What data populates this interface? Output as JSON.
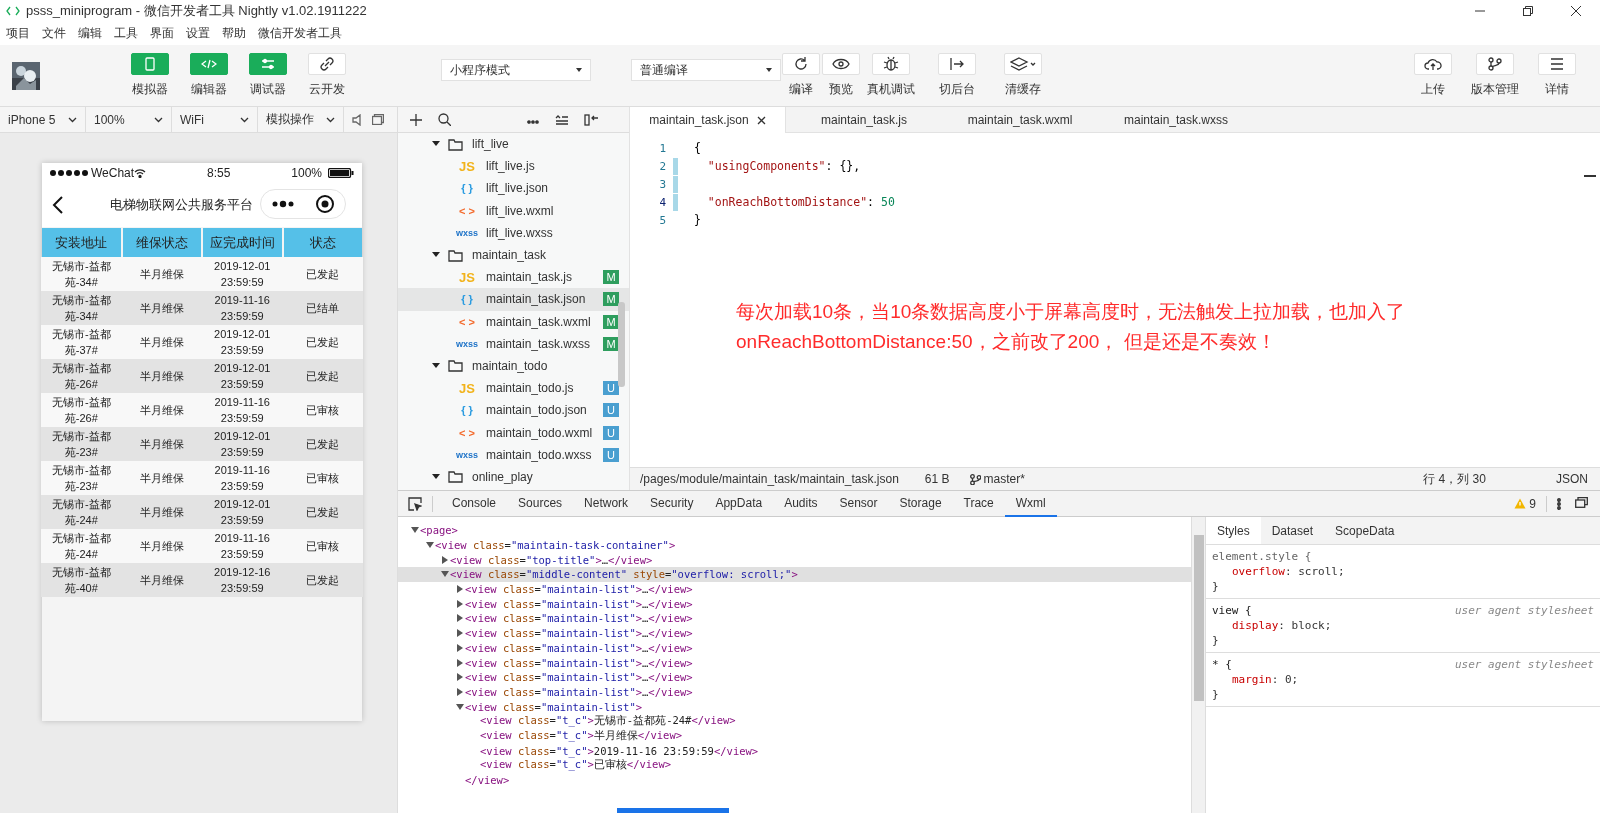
{
  "window": {
    "title": "psss_miniprogram - 微信开发者工具 Nightly v1.02.1911222"
  },
  "menu": [
    "项目",
    "文件",
    "编辑",
    "工具",
    "界面",
    "设置",
    "帮助",
    "微信开发者工具"
  ],
  "toolbar": {
    "view_buttons": [
      {
        "label": "模拟器",
        "kind": "phone",
        "on": true
      },
      {
        "label": "编辑器",
        "kind": "code",
        "on": true
      },
      {
        "label": "调试器",
        "kind": "sliders",
        "on": true
      },
      {
        "label": "云开发",
        "kind": "link",
        "on": false
      }
    ],
    "mode_select": "小程序模式",
    "compile_select": "普通编译",
    "actions": [
      {
        "label": "编译",
        "kind": "refresh"
      },
      {
        "label": "预览",
        "kind": "eye"
      },
      {
        "label": "真机调试",
        "kind": "bug"
      },
      {
        "label": "切后台",
        "kind": "exit"
      },
      {
        "label": "清缓存",
        "kind": "layers"
      }
    ],
    "right_actions": [
      {
        "label": "上传",
        "kind": "upload"
      },
      {
        "label": "版本管理",
        "kind": "branch"
      },
      {
        "label": "详情",
        "kind": "menu"
      }
    ]
  },
  "simulator": {
    "device": "iPhone 5",
    "zoom": "100%",
    "network": "WiFi",
    "operation": "模拟操作",
    "phone": {
      "carrier": "WeChat",
      "time": "8:55",
      "battery": "100%",
      "nav_title": "电梯物联网公共服务平台",
      "columns": [
        "安装地址",
        "维保状态",
        "应完成时间",
        "状态"
      ],
      "rows": [
        [
          "无锡市-益都苑-34#",
          "半月维保",
          "2019-12-01 23:59:59",
          "已发起"
        ],
        [
          "无锡市-益都苑-34#",
          "半月维保",
          "2019-11-16 23:59:59",
          "已结单"
        ],
        [
          "无锡市-益都苑-37#",
          "半月维保",
          "2019-12-01 23:59:59",
          "已发起"
        ],
        [
          "无锡市-益都苑-26#",
          "半月维保",
          "2019-12-01 23:59:59",
          "已发起"
        ],
        [
          "无锡市-益都苑-26#",
          "半月维保",
          "2019-11-16 23:59:59",
          "已审核"
        ],
        [
          "无锡市-益都苑-23#",
          "半月维保",
          "2019-12-01 23:59:59",
          "已发起"
        ],
        [
          "无锡市-益都苑-23#",
          "半月维保",
          "2019-11-16 23:59:59",
          "已审核"
        ],
        [
          "无锡市-益都苑-24#",
          "半月维保",
          "2019-12-01 23:59:59",
          "已发起"
        ],
        [
          "无锡市-益都苑-24#",
          "半月维保",
          "2019-11-16 23:59:59",
          "已审核"
        ],
        [
          "无锡市-益都苑-40#",
          "半月维保",
          "2019-12-16 23:59:59",
          "已发起"
        ]
      ]
    }
  },
  "file_tree": [
    {
      "name": "lift_live",
      "expanded": true,
      "children": [
        {
          "name": "lift_live.js",
          "icon": "JS",
          "kind": "js",
          "selected": false
        },
        {
          "name": "lift_live.json",
          "icon": "{ }",
          "kind": "json",
          "selected": false
        },
        {
          "name": "lift_live.wxml",
          "icon": "< >",
          "kind": "wxml",
          "selected": false
        },
        {
          "name": "lift_live.wxss",
          "icon": "wxss",
          "kind": "wxss",
          "selected": false
        }
      ]
    },
    {
      "name": "maintain_task",
      "expanded": true,
      "children": [
        {
          "name": "maintain_task.js",
          "icon": "JS",
          "kind": "js",
          "selected": false,
          "badge": {
            "label": "M",
            "color": "#2e9e5e"
          }
        },
        {
          "name": "maintain_task.json",
          "icon": "{ }",
          "kind": "json",
          "selected": true,
          "badge": {
            "label": "M",
            "color": "#2e9e5e"
          }
        },
        {
          "name": "maintain_task.wxml",
          "icon": "< >",
          "kind": "wxml",
          "selected": false,
          "badge": {
            "label": "M",
            "color": "#2e9e5e"
          }
        },
        {
          "name": "maintain_task.wxss",
          "icon": "wxss",
          "kind": "wxss",
          "selected": false,
          "badge": {
            "label": "M",
            "color": "#2e9e5e"
          }
        }
      ]
    },
    {
      "name": "maintain_todo",
      "expanded": true,
      "children": [
        {
          "name": "maintain_todo.js",
          "icon": "JS",
          "kind": "js",
          "selected": false,
          "badge": {
            "label": "U",
            "color": "#4a9fd0"
          }
        },
        {
          "name": "maintain_todo.json",
          "icon": "{ }",
          "kind": "json",
          "selected": false,
          "badge": {
            "label": "U",
            "color": "#4a9fd0"
          }
        },
        {
          "name": "maintain_todo.wxml",
          "icon": "< >",
          "kind": "wxml",
          "selected": false,
          "badge": {
            "label": "U",
            "color": "#4a9fd0"
          }
        },
        {
          "name": "maintain_todo.wxss",
          "icon": "wxss",
          "kind": "wxss",
          "selected": false,
          "badge": {
            "label": "U",
            "color": "#4a9fd0"
          }
        }
      ]
    },
    {
      "name": "online_play",
      "expanded": true
    }
  ],
  "editor": {
    "tabs": [
      {
        "label": "maintain_task.json",
        "selected": true
      },
      {
        "label": "maintain_task.js",
        "selected": false
      },
      {
        "label": "maintain_task.wxml",
        "selected": false
      },
      {
        "label": "maintain_task.wxss",
        "selected": false
      }
    ],
    "lines": [
      {
        "number": "1",
        "modified": false,
        "current": false,
        "tokens": [
          {
            "kind": "punct",
            "text": "{"
          }
        ]
      },
      {
        "number": "2",
        "modified": true,
        "current": false,
        "tokens": [
          {
            "kind": "key",
            "text": "  \"usingComponents\""
          },
          {
            "kind": "punct",
            "text": ": {},"
          }
        ]
      },
      {
        "number": "3",
        "modified": true,
        "current": false
      },
      {
        "number": "4",
        "modified": true,
        "current": true,
        "tokens": [
          {
            "kind": "key",
            "text": "  \"onReachBottomDistance\""
          },
          {
            "kind": "punct",
            "text": ": "
          },
          {
            "kind": "number",
            "text": "50"
          }
        ]
      },
      {
        "number": "5",
        "modified": false,
        "current": false,
        "tokens": [
          {
            "kind": "punct",
            "text": "}"
          }
        ]
      }
    ],
    "annotation": [
      "每次加载10条，当10条数据高度小于屏幕高度时，无法触发上拉加载，也加入了",
      "onReachBottomDistance:50，之前改了200， 但是还是不奏效！"
    ],
    "status": {
      "path": "/pages/module/maintain_task/maintain_task.json",
      "size": "61 B",
      "branch": "master*",
      "position": "行 4，列 30",
      "language": "JSON"
    }
  },
  "devtools": {
    "tabs": [
      {
        "label": "Console",
        "selected": false
      },
      {
        "label": "Sources",
        "selected": false
      },
      {
        "label": "Network",
        "selected": false
      },
      {
        "label": "Security",
        "selected": false
      },
      {
        "label": "AppData",
        "selected": false
      },
      {
        "label": "Audits",
        "selected": false
      },
      {
        "label": "Sensor",
        "selected": false
      },
      {
        "label": "Storage",
        "selected": false
      },
      {
        "label": "Trace",
        "selected": false
      },
      {
        "label": "Wxml",
        "selected": true
      }
    ],
    "warnings": "9",
    "wxml": [
      {
        "text": "<page>",
        "expanded": true,
        "selected": false,
        "children": [
          {
            "text": "<view class=\"maintain-task-container\">",
            "expanded": true,
            "selected": false,
            "children": [
              {
                "text": "<view class=\"top-title\">…</view>",
                "expanded": false,
                "selected": false
              },
              {
                "text": "<view class=\"middle-content\" style=\"overflow: scroll;\">",
                "expanded": true,
                "selected": true,
                "children": [
                  {
                    "text": "<view class=\"maintain-list\">…</view>",
                    "expanded": false,
                    "selected": false
                  },
                  {
                    "text": "<view class=\"maintain-list\">…</view>",
                    "expanded": false,
                    "selected": false
                  },
                  {
                    "text": "<view class=\"maintain-list\">…</view>",
                    "expanded": false,
                    "selected": false
                  },
                  {
                    "text": "<view class=\"maintain-list\">…</view>",
                    "expanded": false,
                    "selected": false
                  },
                  {
                    "text": "<view class=\"maintain-list\">…</view>",
                    "expanded": false,
                    "selected": false
                  },
                  {
                    "text": "<view class=\"maintain-list\">…</view>",
                    "expanded": false,
                    "selected": false
                  },
                  {
                    "text": "<view class=\"maintain-list\">…</view>",
                    "expanded": false,
                    "selected": false
                  },
                  {
                    "text": "<view class=\"maintain-list\">…</view>",
                    "expanded": false,
                    "selected": false
                  },
                  {
                    "text": "<view class=\"maintain-list\">",
                    "expanded": true,
                    "selected": false,
                    "closing": "</view>",
                    "children": [
                      {
                        "text": "<view class=\"t_c\">无锡市-益都苑-24#</view>",
                        "selected": false
                      },
                      {
                        "text": "<view class=\"t_c\">半月维保</view>",
                        "selected": false
                      },
                      {
                        "text": "<view class=\"t_c\">2019-11-16 23:59:59</view>",
                        "selected": false
                      },
                      {
                        "text": "<view class=\"t_c\">已审核</view>",
                        "selected": false
                      }
                    ]
                  }
                ]
              }
            ]
          }
        ]
      }
    ],
    "styles": {
      "tabs": [
        {
          "label": "Styles",
          "selected": true
        },
        {
          "label": "Dataset",
          "selected": false
        },
        {
          "label": "ScopeData",
          "selected": false
        }
      ],
      "rules": [
        {
          "selector": "element.style {",
          "declarations": [
            "overflow: scroll;"
          ],
          "close": "}"
        },
        {
          "selector": "view {",
          "source": "user agent stylesheet",
          "declarations": [
            "display: block;"
          ],
          "close": "}"
        },
        {
          "selector": "* {",
          "source": "user agent stylesheet",
          "declarations": [
            "margin: 0;"
          ],
          "close": "}"
        }
      ]
    }
  }
}
